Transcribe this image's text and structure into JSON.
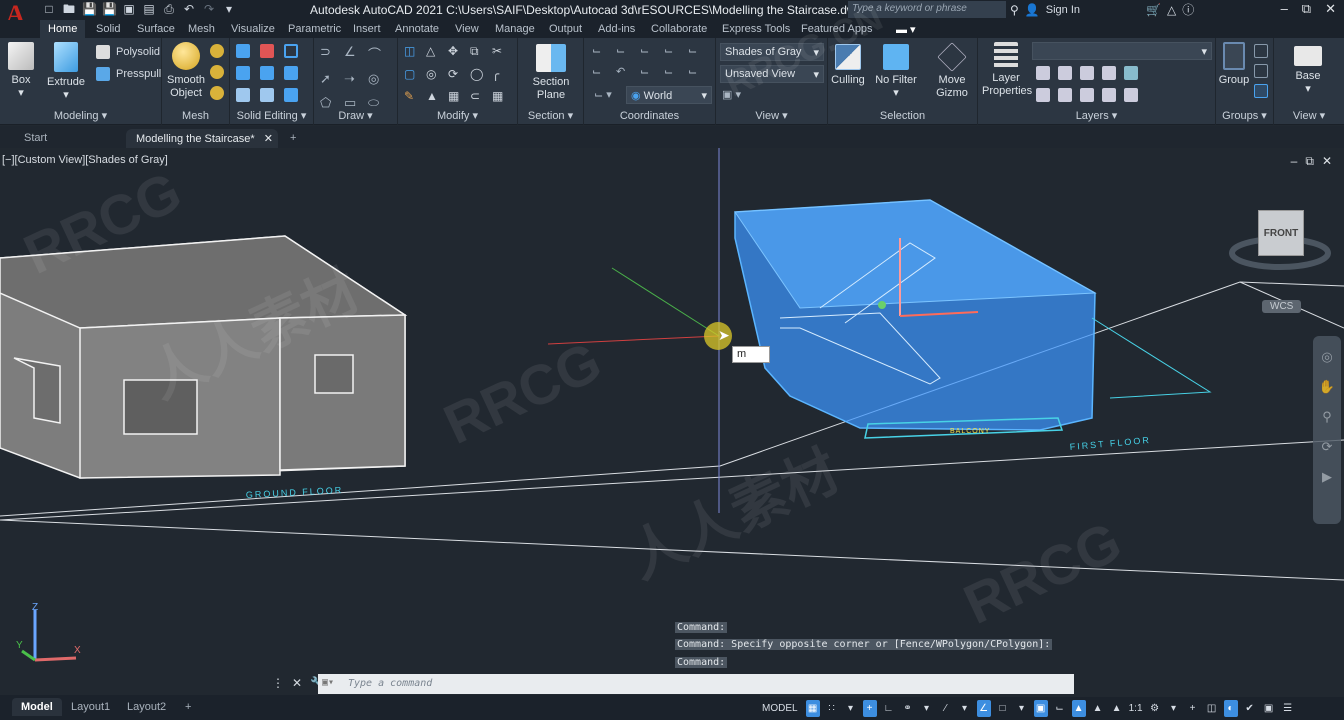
{
  "app": {
    "title": "Autodesk AutoCAD 2021    C:\\Users\\SAIF\\Desktop\\Autocad 3d\\rESOURCES\\Modelling the Staircase.dwg",
    "logo": "A",
    "search_placeholder": "Type a keyword or phrase",
    "sign_in": "Sign In"
  },
  "quick_access": [
    "new-icon",
    "open-icon",
    "save-icon",
    "save-as-icon",
    "open-from-web-icon",
    "save-to-web-icon",
    "plot-icon",
    "undo-icon",
    "redo-icon",
    "customize-icon"
  ],
  "ribbon_tabs": [
    {
      "label": "Home",
      "active": true
    },
    {
      "label": "Solid"
    },
    {
      "label": "Surface"
    },
    {
      "label": "Mesh"
    },
    {
      "label": "Visualize"
    },
    {
      "label": "Parametric"
    },
    {
      "label": "Insert"
    },
    {
      "label": "Annotate"
    },
    {
      "label": "View"
    },
    {
      "label": "Manage"
    },
    {
      "label": "Output"
    },
    {
      "label": "Add-ins"
    },
    {
      "label": "Collaborate"
    },
    {
      "label": "Express Tools"
    },
    {
      "label": "Featured Apps"
    }
  ],
  "ribbon": {
    "modeling": {
      "label": "Modeling",
      "box": "Box",
      "extrude": "Extrude",
      "polysolid": "Polysolid",
      "presspull": "Presspull"
    },
    "mesh": {
      "label": "Mesh",
      "smooth": "Smooth",
      "object": "Object"
    },
    "solid_editing": {
      "label": "Solid Editing"
    },
    "draw": {
      "label": "Draw"
    },
    "modify": {
      "label": "Modify"
    },
    "section": {
      "label": "Section",
      "plane1": "Section",
      "plane2": "Plane"
    },
    "coordinates": {
      "label": "Coordinates",
      "ucs": "World"
    },
    "view": {
      "label": "View",
      "visual_style": "Shades of Gray",
      "named_view": "Unsaved View"
    },
    "selection": {
      "label": "Selection",
      "culling": "Culling",
      "nofilter": "No Filter",
      "gizmo1": "Move",
      "gizmo2": "Gizmo"
    },
    "layers": {
      "label": "Layers",
      "props1": "Layer",
      "props2": "Properties",
      "current_layer": ""
    },
    "groups": {
      "label": "Groups",
      "group": "Group"
    },
    "view2": {
      "label": "View",
      "base": "Base"
    }
  },
  "doc_tabs": [
    {
      "label": "Start"
    },
    {
      "label": "Modelling the Staircase*",
      "active": true
    }
  ],
  "viewport": {
    "label": "[−][Custom View][Shades of Gray]",
    "viewcube_face": "FRONT",
    "wcs": "WCS",
    "dynamic_input": "m",
    "labels": {
      "ground": "GROUND FLOOR",
      "first": "FIRST FLOOR",
      "balcony": "BALCONY"
    },
    "axes": {
      "x": "X",
      "y": "Y",
      "z": "Z"
    }
  },
  "command": {
    "history": [
      "Command:",
      "Command: Specify opposite corner or [Fence/WPolygon/CPolygon]:",
      "Command:"
    ],
    "placeholder": "Type a command"
  },
  "layout_tabs": [
    {
      "label": "Model",
      "active": true
    },
    {
      "label": "Layout1"
    },
    {
      "label": "Layout2"
    }
  ],
  "statusbar": {
    "model": "MODEL",
    "scale": "1:1",
    "items": [
      "grid-icon",
      "snap-icon",
      "ortho-icon",
      "polar-icon",
      "isodraft-icon",
      "osnap-track-icon",
      "osnap-icon",
      "lineweight-icon",
      "transparency-icon",
      "selection-cycling-icon",
      "3d-osnap-icon",
      "annotation-visibility-icon",
      "autoscale-icon",
      "workspace-icon",
      "annotation-monitor-icon",
      "units-icon",
      "quick-properties-icon",
      "lock-ui-icon",
      "isolate-icon",
      "graphics-performance-icon",
      "clean-screen-icon",
      "customize-icon"
    ]
  },
  "watermarks": [
    "RRCG",
    "人人素材",
    "RRCG.CN"
  ]
}
